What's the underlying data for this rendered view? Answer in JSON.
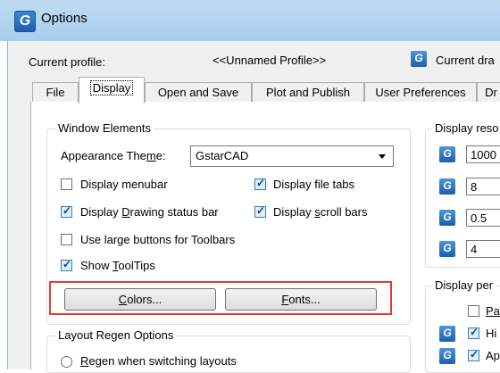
{
  "window": {
    "title": "Options",
    "app_icon_glyph": "G"
  },
  "profile": {
    "label": "Current profile:",
    "name": "<<Unnamed Profile>>",
    "current_drawing_label": "Current dra"
  },
  "tabs": [
    {
      "label": "File",
      "active": false
    },
    {
      "label": "Display",
      "active": true
    },
    {
      "label": "Open and Save",
      "active": false
    },
    {
      "label": "Plot and Publish",
      "active": false
    },
    {
      "label": "User Preferences",
      "active": false
    },
    {
      "label": "Dr",
      "active": false
    }
  ],
  "window_elements": {
    "title": "Window Elements",
    "theme_label_pre": "Appearance The",
    "theme_label_key": "m",
    "theme_label_post": "e:",
    "theme_value": "GstarCAD",
    "checkboxes": [
      {
        "pre": "Display menubar",
        "key": "",
        "post": "",
        "checked": false
      },
      {
        "pre": "Display file tabs",
        "key": "",
        "post": "",
        "checked": true
      },
      {
        "pre": "Display ",
        "key": "D",
        "post": "rawing status bar",
        "checked": true
      },
      {
        "pre": "Display ",
        "key": "s",
        "post": "croll bars",
        "checked": true
      },
      {
        "pre": "Use large buttons for Toolbars",
        "key": "",
        "post": "",
        "checked": false
      },
      {
        "pre": "Show ",
        "key": "T",
        "post": "oolTips",
        "checked": true
      }
    ],
    "colors_button": {
      "key": "C",
      "post": "olors..."
    },
    "fonts_button": {
      "key": "F",
      "post": "onts..."
    }
  },
  "layout_regen": {
    "title": "Layout Regen Options",
    "option1_key": "R",
    "option1_post": "egen when switching layouts"
  },
  "display_resolution": {
    "title": "Display reso",
    "values": [
      "1000",
      "8",
      "0.5",
      "4"
    ]
  },
  "display_performance": {
    "title": "Display per",
    "items": [
      {
        "text": "Pa",
        "checked": false,
        "underline_first": true
      },
      {
        "text": "Hi",
        "checked": true,
        "underline_first": false
      },
      {
        "text": "Ap",
        "checked": true,
        "underline_first": false
      }
    ]
  }
}
